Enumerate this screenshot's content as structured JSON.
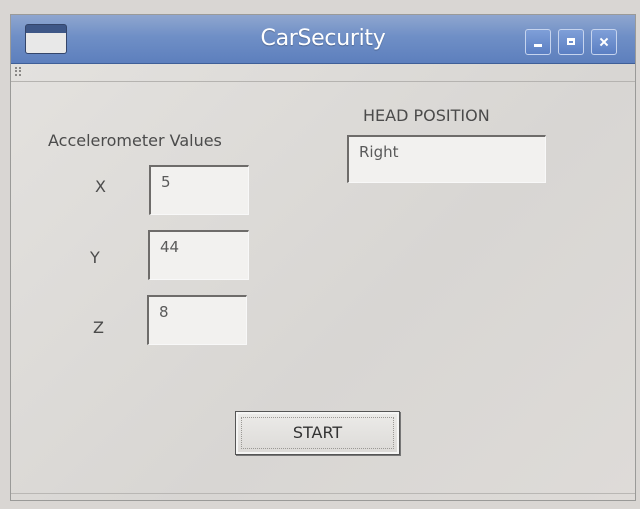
{
  "window": {
    "title": "CarSecurity"
  },
  "accelerometer": {
    "heading": "Accelerometer Values",
    "x_label": "X",
    "x_value": "5",
    "y_label": "Y",
    "y_value": "44",
    "z_label": "Z",
    "z_value": "8"
  },
  "head_position": {
    "heading": "HEAD POSITION",
    "value": "Right"
  },
  "buttons": {
    "start_label": "START"
  },
  "icons": [
    "app-window-icon",
    "minimize-icon",
    "maximize-icon",
    "close-icon",
    "toolbar-grip-icon"
  ]
}
